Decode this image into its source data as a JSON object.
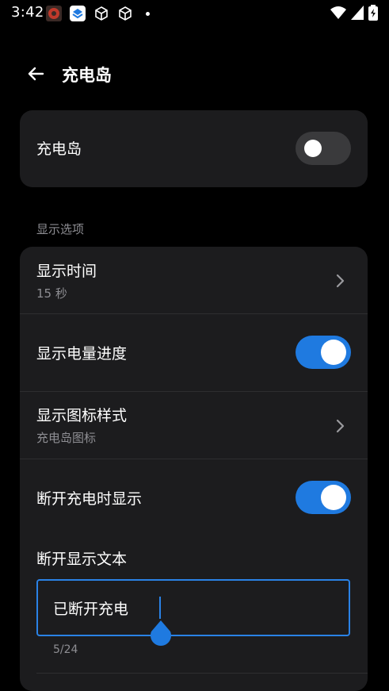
{
  "status_bar": {
    "time": "3:42",
    "notification_icons": [
      "app-icon-red-circle",
      "layers-icon",
      "cube-icon",
      "cube-icon",
      "more-dot-icon"
    ],
    "system_icons": [
      "wifi-icon",
      "signal-icon",
      "battery-charging-icon"
    ]
  },
  "app_bar": {
    "title": "充电岛"
  },
  "charging_island": {
    "label": "充电岛",
    "enabled": false
  },
  "display_options": {
    "header": "显示选项",
    "show_time": {
      "label": "显示时间",
      "value": "15 秒"
    },
    "show_battery_progress": {
      "label": "显示电量进度",
      "enabled": true
    },
    "icon_style": {
      "label": "显示图标样式",
      "value": "充电岛图标"
    },
    "show_on_disconnect": {
      "label": "断开充电时显示",
      "enabled": true
    },
    "disconnect_text": {
      "label": "断开显示文本",
      "value": "已断开充电",
      "counter": "5/24"
    }
  },
  "colors": {
    "accent": "#1f7ae0",
    "card": "#1c1c1e",
    "secondary_text": "#8e8e93"
  }
}
